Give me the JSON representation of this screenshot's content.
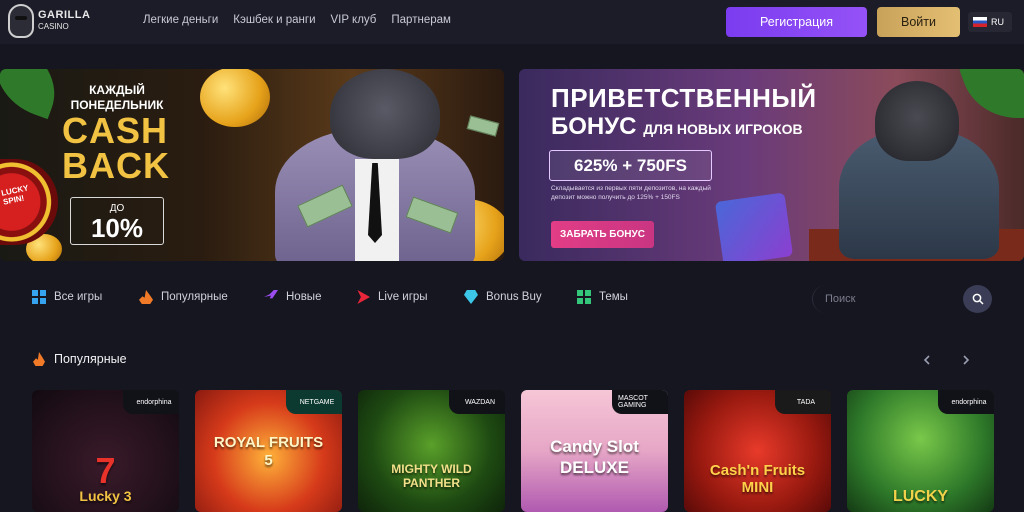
{
  "header": {
    "logo_line1": "GARILLA",
    "logo_line2": "CASINO",
    "nav": [
      "Легкие деньги",
      "Кэшбек и ранги",
      "VIP клуб",
      "Партнерам"
    ],
    "register_label": "Регистрация",
    "login_label": "Войти",
    "lang": "RU"
  },
  "banners": {
    "left": {
      "week_line1": "КАЖДЫЙ",
      "week_line2": "ПОНЕДЕЛЬНИК",
      "cash": "CASH",
      "back": "BACK",
      "upto": "ДО",
      "percent": "10%",
      "wheel_label1": "LUCKY",
      "wheel_label2": "SPIN!"
    },
    "right": {
      "line1": "ПРИВЕТСТВЕННЫЙ",
      "line2_big": "БОНУС",
      "line2_small": "ДЛЯ НОВЫХ ИГРОКОВ",
      "offer": "625% + 750FS",
      "desc": "Складывается из первых пяти депозитов, на каждый депозит можно получить до 125% + 150FS",
      "button": "ЗАБРАТЬ БОНУС"
    }
  },
  "categories": {
    "items": [
      {
        "label": "Все игры",
        "icon": "grid-icon"
      },
      {
        "label": "Популярные",
        "icon": "fire-icon"
      },
      {
        "label": "Новые",
        "icon": "rocket-icon"
      },
      {
        "label": "Live игры",
        "icon": "play-icon"
      },
      {
        "label": "Bonus Buy",
        "icon": "diamond-icon"
      },
      {
        "label": "Темы",
        "icon": "grid-icon"
      }
    ],
    "search_placeholder": "Поиск"
  },
  "popular": {
    "title": "Популярные",
    "games": [
      {
        "title": "Lucky 3",
        "provider": "endorphina"
      },
      {
        "title": "ROYAL FRUITS 5",
        "provider": "NETGAME"
      },
      {
        "title": "MIGHTY WILD PANTHER",
        "provider": "WAZDAN"
      },
      {
        "title": "Candy Slot DELUXE",
        "provider": "MASCOT GAMING"
      },
      {
        "title": "Cash'n Fruits MINI",
        "provider": "TADA"
      },
      {
        "title": "LUCKY",
        "provider": "endorphina"
      }
    ]
  },
  "colors": {
    "background": "#15161f",
    "register": "#8448f3",
    "login": "#d9b168",
    "accent_pink": "#d93a85"
  }
}
